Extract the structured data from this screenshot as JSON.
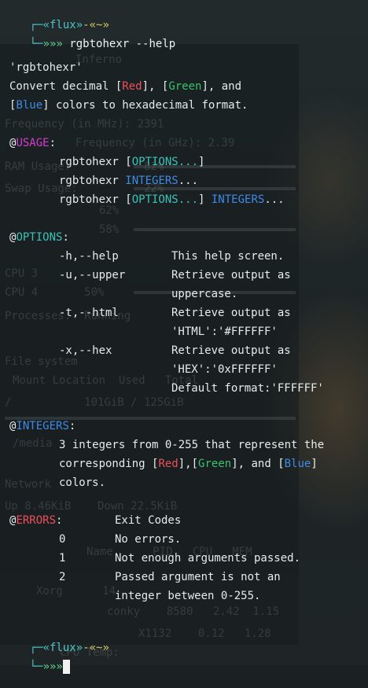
{
  "prompt": {
    "user": "«flux»",
    "sep": "-«~»",
    "arrows": "»»»",
    "command": "rgbtohexr --help"
  },
  "help": {
    "name": "'rgbtohexr'",
    "desc1_a": "Convert decimal [",
    "red": "Red",
    "desc1_b": "], [",
    "green": "Green",
    "desc1_c": "], and",
    "desc2_a": "[",
    "blue": "Blue",
    "desc2_b": "] colors to hexadecimal format.",
    "usage_at": "@",
    "usage_label": "USAGE",
    "colon": ":",
    "usage": [
      {
        "a": "rgbtohexr [",
        "b": "OPTIONS...",
        "c": "]"
      },
      {
        "a": "rgbtohexr ",
        "b": "INTEGERS",
        "c": "..."
      },
      {
        "a": "rgbtohexr [",
        "b": "OPTIONS...",
        "c": "] ",
        "d": "INTEGERS",
        "e": "..."
      }
    ],
    "options_label": "OPTIONS",
    "options": [
      {
        "flag": "-h,--help",
        "desc": "This help screen."
      },
      {
        "flag": "-u,--upper",
        "desc": "Retrieve output as"
      },
      {
        "flag": "",
        "desc": "uppercase."
      },
      {
        "flag": "-t,--html",
        "desc": "Retrieve output as"
      },
      {
        "flag": "",
        "desc": "'HTML':'#FFFFFF'"
      },
      {
        "flag": "-x,--hex",
        "desc": "Retrieve output as"
      },
      {
        "flag": "",
        "desc": "'HEX':'0xFFFFFF'"
      },
      {
        "flag": "",
        "desc": "Default format:'FFFFFF'"
      }
    ],
    "integers_label": "INTEGERS",
    "integers_desc1": "3 integers from 0-255 that represent the",
    "integers_desc2_a": "corresponding [",
    "integers_desc2_b": "],[",
    "integers_desc2_c": "], and [",
    "integers_desc2_d": "]",
    "integers_desc3": "colors.",
    "errors_label": "ERRORS",
    "exit_codes": "Exit Codes",
    "errors": [
      {
        "code": "0",
        "desc": "No errors."
      },
      {
        "code": "1",
        "desc": "Not enough arguments passed."
      },
      {
        "code": "2",
        "desc": "Passed argument is not an"
      },
      {
        "code": "",
        "desc": "integer between 0-255."
      }
    ]
  },
  "background_text": [
    "Inferno",
    "Frequency (in MHz): 2391",
    "Frequency (in GHz): 2.39",
    "RAM Usage:           82%",
    "Swap Usage:          22%",
    "62%",
    "58%",
    "CPU 3",
    "CPU 4       50%",
    "Processes:  Running",
    "File system",
    "Mount Location  Used   Total",
    "/           101GiB / 125GiB",
    "/media",
    "Network",
    "Up 8.46KiB    Down 22.5KiB",
    "Name      PID   CPU   MEM",
    "Xorg      14",
    "conky    8580   2.42  1.15",
    "X1132    0.12   1.28",
    "CPU Temp:"
  ],
  "colors": {
    "red": "#ec4f5a",
    "green": "#37c26e",
    "blue": "#3f8ae6",
    "magenta": "#d43cd2",
    "teal": "#39c2b8",
    "prompt_cyan": "#4fc3c9"
  }
}
